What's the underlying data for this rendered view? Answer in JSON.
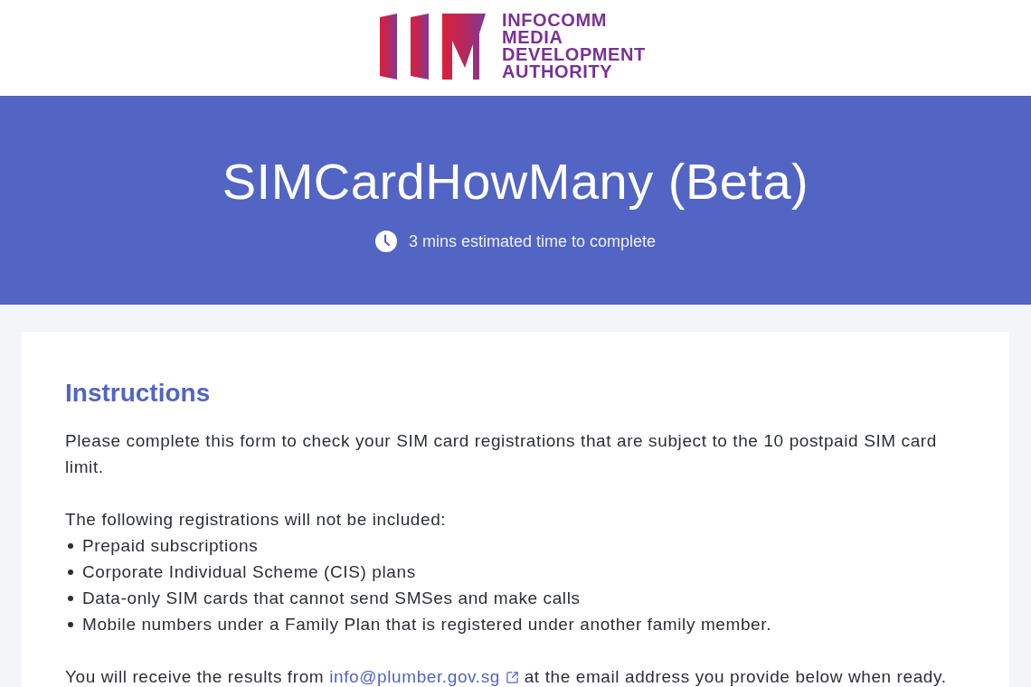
{
  "header": {
    "logo_lines": [
      "INFOCOMM",
      "MEDIA",
      "DEVELOPMENT",
      "AUTHORITY"
    ]
  },
  "banner": {
    "title": "SIMCardHowMany (Beta)",
    "estimate": "3 mins estimated time to complete"
  },
  "instructions": {
    "heading": "Instructions",
    "intro": "Please complete this form to check your SIM card registrations that are subject to the 10 postpaid SIM card limit.",
    "exclusions_intro": "The following registrations will not be included:",
    "exclusions": [
      "Prepaid subscriptions",
      "Corporate Individual Scheme (CIS) plans",
      "Data-only SIM cards that cannot send SMSes and make calls",
      "Mobile numbers under a Family Plan that is registered under another family member."
    ],
    "results_note": {
      "before": "You will receive the results from",
      "link": "info@plumber.gov.sg",
      "after": "at the email address you provide below when ready."
    }
  }
}
